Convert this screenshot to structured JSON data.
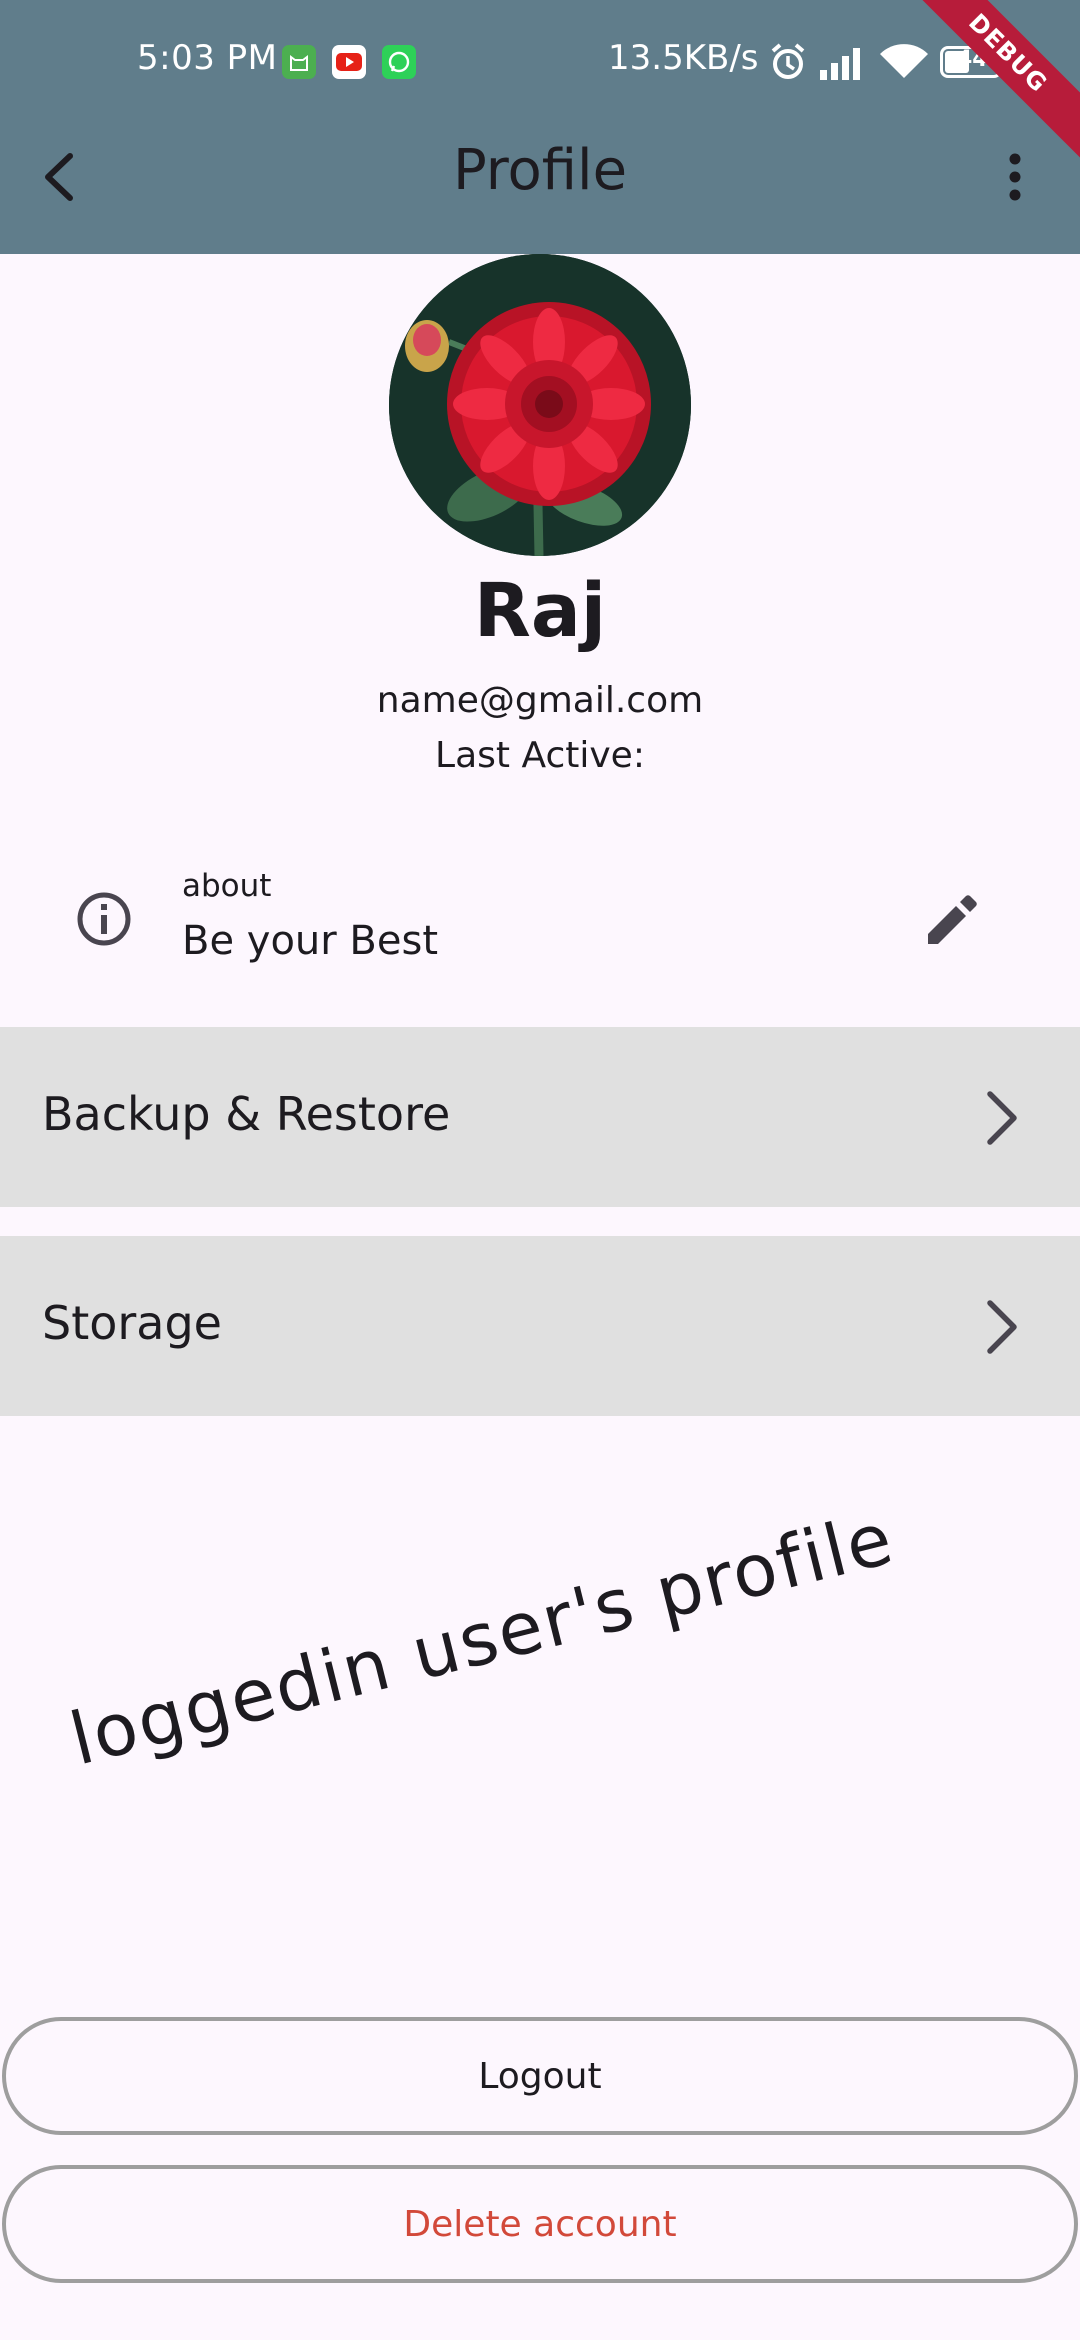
{
  "status_bar": {
    "time": "5:03 PM",
    "speed": "13.5KB/s",
    "battery": "44",
    "notification_icons": [
      "cat-app-icon",
      "youtube-icon",
      "whatsapp-icon"
    ]
  },
  "debug_banner": "DEBUG",
  "appbar": {
    "title": "Profile",
    "color": "#607d8b"
  },
  "profile": {
    "name": "Raj",
    "email": "name@gmail.com",
    "last_active": "Last Active:"
  },
  "about": {
    "label": "about",
    "text": "Be your Best"
  },
  "menu": [
    {
      "label": "Backup & Restore"
    },
    {
      "label": "Storage"
    }
  ],
  "watermark": "loggedin user's profile",
  "buttons": {
    "logout": "Logout",
    "delete": "Delete account",
    "delete_color": "#d2493a"
  }
}
